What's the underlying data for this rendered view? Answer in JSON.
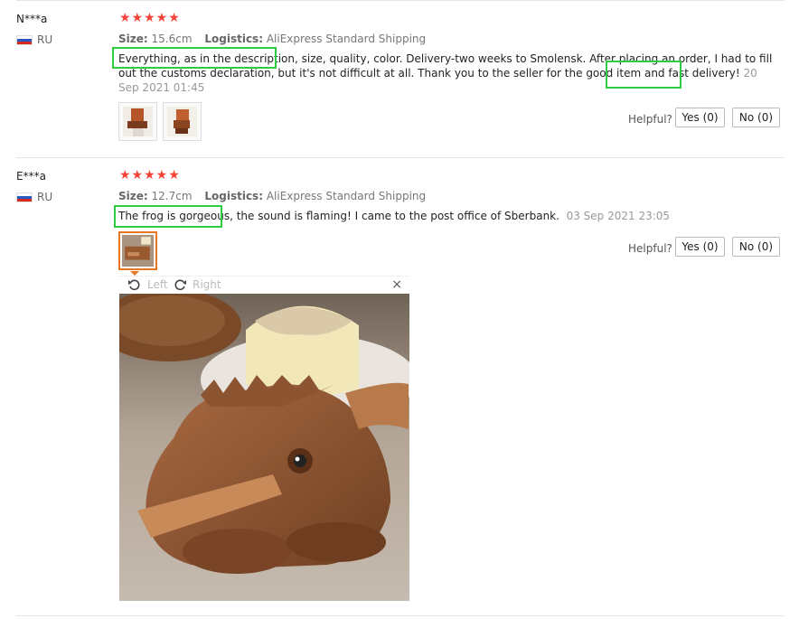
{
  "reviews": [
    {
      "name": "N***a",
      "country": "RU",
      "stars": "★★★★★",
      "size_label": "Size:",
      "size_value": "15.6cm",
      "logistics_label": "Logistics:",
      "logistics_value": "AliExpress Standard Shipping",
      "text_line1": "Everything, as in the description, size, quality, color. Delivery-two weeks to Smolensk. After placing an order, I had to fill",
      "text_line2": "out the customs declaration, but it's not difficult at all. Thank you to the seller for the good item and fast delivery!",
      "date_part1": "20",
      "date_part2": "Sep 2021 01:45",
      "helpful_label": "Helpful?",
      "yes_label": "Yes (0)",
      "no_label": "No (0)"
    },
    {
      "name": "E***a",
      "country": "RU",
      "stars": "★★★★★",
      "size_label": "Size:",
      "size_value": "12.7cm",
      "logistics_label": "Logistics:",
      "logistics_value": "AliExpress Standard Shipping",
      "text": "The frog is gorgeous, the sound is flaming! I came to the post office of Sberbank.",
      "date": "03 Sep 2021 23:05",
      "helpful_label": "Helpful?",
      "yes_label": "Yes (0)",
      "no_label": "No (0)"
    }
  ],
  "viewer": {
    "rotate_left_label": "Left",
    "rotate_right_label": "Right",
    "close_label": "×"
  },
  "colors": {
    "star": "#f44336",
    "highlight": "#2ecc40",
    "selected_thumb": "#e87722"
  }
}
